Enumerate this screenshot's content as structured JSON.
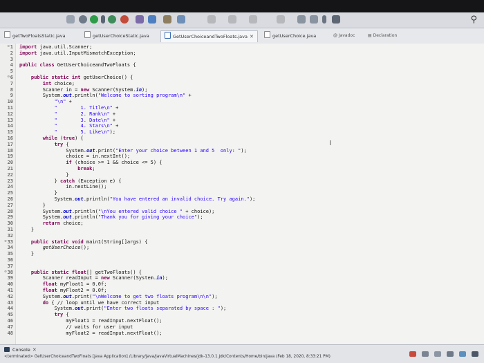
{
  "toolbar": {
    "search_icon": "search-icon"
  },
  "tabs": [
    {
      "label": "getTwoFloatsStatic.java",
      "active": false
    },
    {
      "label": "getUserChoiceStatic.java",
      "active": false
    },
    {
      "label": "GetUserChoiceandTwoFloats.java",
      "active": true,
      "close": "✕"
    },
    {
      "label": "getUserChoice.java",
      "active": false
    }
  ],
  "right_tabs": {
    "javadoc": "Javadoc",
    "declaration": "Declaration"
  },
  "editor": {
    "lines": [
      {
        "n": "1",
        "fold": true,
        "code": [
          [
            "import",
            "kw"
          ],
          [
            " java.util.Scanner;",
            ""
          ]
        ]
      },
      {
        "n": "2",
        "code": [
          [
            "import",
            "kw"
          ],
          [
            " java.util.InputMismatchException;",
            ""
          ]
        ]
      },
      {
        "n": "3",
        "code": []
      },
      {
        "n": "4",
        "code": [
          [
            "public class",
            "kw"
          ],
          [
            " GetUserChoiceandTwoFloats {",
            ""
          ]
        ]
      },
      {
        "n": "5",
        "code": []
      },
      {
        "n": "6",
        "fold": true,
        "code": [
          [
            "    ",
            ""
          ],
          [
            "public static int",
            "kw"
          ],
          [
            " getUserChoice() {",
            ""
          ]
        ]
      },
      {
        "n": "7",
        "code": [
          [
            "        ",
            ""
          ],
          [
            "int",
            "kw"
          ],
          [
            " choice;",
            ""
          ]
        ]
      },
      {
        "n": "8",
        "code": [
          [
            "        Scanner in = ",
            ""
          ],
          [
            "new",
            "kw"
          ],
          [
            " Scanner(System.",
            ""
          ],
          [
            "in",
            "fd"
          ],
          [
            ");",
            ""
          ]
        ]
      },
      {
        "n": "9",
        "code": [
          [
            "        System.",
            ""
          ],
          [
            "out",
            "fd"
          ],
          [
            ".println(",
            ""
          ],
          [
            "\"Welcome to sorting program\\n\"",
            "st"
          ],
          [
            " +",
            ""
          ]
        ]
      },
      {
        "n": "10",
        "code": [
          [
            "            ",
            ""
          ],
          [
            "\"\\n\"",
            "st"
          ],
          [
            " +",
            ""
          ]
        ]
      },
      {
        "n": "11",
        "code": [
          [
            "            ",
            ""
          ],
          [
            "\"",
            "st"
          ],
          [
            "        ",
            ""
          ],
          [
            "1. Title\\n\"",
            "st"
          ],
          [
            " +",
            ""
          ]
        ]
      },
      {
        "n": "12",
        "code": [
          [
            "            ",
            ""
          ],
          [
            "\"",
            "st"
          ],
          [
            "        ",
            ""
          ],
          [
            "2. Rank\\n\"",
            "st"
          ],
          [
            " +",
            ""
          ]
        ]
      },
      {
        "n": "13",
        "code": [
          [
            "            ",
            ""
          ],
          [
            "\"",
            "st"
          ],
          [
            "        ",
            ""
          ],
          [
            "3. Date\\n\"",
            "st"
          ],
          [
            " +",
            ""
          ]
        ]
      },
      {
        "n": "14",
        "code": [
          [
            "            ",
            ""
          ],
          [
            "\"",
            "st"
          ],
          [
            "        ",
            ""
          ],
          [
            "4. Stars\\n\"",
            "st"
          ],
          [
            " +",
            ""
          ]
        ]
      },
      {
        "n": "15",
        "code": [
          [
            "            ",
            ""
          ],
          [
            "\"",
            "st"
          ],
          [
            "        ",
            ""
          ],
          [
            "5. Like\\n\"",
            "st"
          ],
          [
            ");",
            ""
          ]
        ]
      },
      {
        "n": "16",
        "code": [
          [
            "        ",
            ""
          ],
          [
            "while",
            "kw"
          ],
          [
            " (",
            ""
          ],
          [
            "true",
            "kw"
          ],
          [
            ") {",
            ""
          ]
        ]
      },
      {
        "n": "17",
        "code": [
          [
            "            ",
            ""
          ],
          [
            "try",
            "kw"
          ],
          [
            " {",
            ""
          ]
        ]
      },
      {
        "n": "18",
        "code": [
          [
            "                System.",
            ""
          ],
          [
            "out",
            "fd"
          ],
          [
            ".print(",
            ""
          ],
          [
            "\"Enter your choice between 1 and 5  only: \"",
            "st"
          ],
          [
            ");",
            ""
          ]
        ]
      },
      {
        "n": "19",
        "code": [
          [
            "                choice = in.nextInt();",
            ""
          ]
        ]
      },
      {
        "n": "20",
        "code": [
          [
            "                ",
            ""
          ],
          [
            "if",
            "kw"
          ],
          [
            " (choice >= 1 && choice <= 5) {",
            ""
          ]
        ]
      },
      {
        "n": "21",
        "code": [
          [
            "                    ",
            ""
          ],
          [
            "break",
            "kw"
          ],
          [
            ";",
            ""
          ]
        ]
      },
      {
        "n": "22",
        "code": [
          [
            "                }",
            ""
          ]
        ]
      },
      {
        "n": "23",
        "code": [
          [
            "            } ",
            ""
          ],
          [
            "catch",
            "kw"
          ],
          [
            " (Exception e) {",
            ""
          ]
        ]
      },
      {
        "n": "24",
        "code": [
          [
            "                in.nextLine();",
            ""
          ]
        ]
      },
      {
        "n": "25",
        "code": [
          [
            "            }",
            ""
          ]
        ]
      },
      {
        "n": "26",
        "code": [
          [
            "            System.",
            ""
          ],
          [
            "out",
            "fd"
          ],
          [
            ".println(",
            ""
          ],
          [
            "\"You have entered an invalid choice. Try again.\"",
            "st"
          ],
          [
            ");",
            ""
          ]
        ]
      },
      {
        "n": "27",
        "code": [
          [
            "        }",
            ""
          ]
        ]
      },
      {
        "n": "28",
        "code": [
          [
            "        System.",
            ""
          ],
          [
            "out",
            "fd"
          ],
          [
            ".println(",
            ""
          ],
          [
            "\"\\nYou entered valid choice \"",
            "st"
          ],
          [
            " + choice);",
            ""
          ]
        ]
      },
      {
        "n": "29",
        "code": [
          [
            "        System.",
            ""
          ],
          [
            "out",
            "fd"
          ],
          [
            ".println(",
            ""
          ],
          [
            "\"Thank you for giving your choice\"",
            "st"
          ],
          [
            ");",
            ""
          ]
        ]
      },
      {
        "n": "30",
        "code": [
          [
            "        ",
            ""
          ],
          [
            "return",
            "kw"
          ],
          [
            " choice;",
            ""
          ]
        ]
      },
      {
        "n": "31",
        "code": [
          [
            "    }",
            ""
          ]
        ]
      },
      {
        "n": "32",
        "code": []
      },
      {
        "n": "33",
        "fold": true,
        "code": [
          [
            "    ",
            ""
          ],
          [
            "public static void",
            "kw"
          ],
          [
            " main1(String[]args) {",
            ""
          ]
        ]
      },
      {
        "n": "34",
        "code": [
          [
            "        ",
            ""
          ],
          [
            "getUserChoice",
            "it"
          ],
          [
            "();",
            ""
          ]
        ]
      },
      {
        "n": "35",
        "code": [
          [
            "    }",
            ""
          ]
        ]
      },
      {
        "n": "36",
        "code": []
      },
      {
        "n": "37",
        "code": []
      },
      {
        "n": "38",
        "fold": true,
        "code": [
          [
            "    ",
            ""
          ],
          [
            "public static float",
            "kw"
          ],
          [
            "[] getTwoFloats() {",
            ""
          ]
        ]
      },
      {
        "n": "39",
        "code": [
          [
            "        Scanner readInput = ",
            ""
          ],
          [
            "new",
            "kw"
          ],
          [
            " Scanner(System.",
            ""
          ],
          [
            "in",
            "fd"
          ],
          [
            ");",
            ""
          ]
        ]
      },
      {
        "n": "40",
        "code": [
          [
            "        ",
            ""
          ],
          [
            "float",
            "kw"
          ],
          [
            " myFloat1 = 0.0f;",
            ""
          ]
        ]
      },
      {
        "n": "41",
        "code": [
          [
            "        ",
            ""
          ],
          [
            "float",
            "kw"
          ],
          [
            " myFloat2 = 0.0f;",
            ""
          ]
        ]
      },
      {
        "n": "42",
        "code": [
          [
            "        System.",
            ""
          ],
          [
            "out",
            "fd"
          ],
          [
            ".print(",
            ""
          ],
          [
            "\"\\nWelcome to get two floats program\\n\\n\"",
            "st"
          ],
          [
            ");",
            ""
          ]
        ]
      },
      {
        "n": "43",
        "code": [
          [
            "        ",
            ""
          ],
          [
            "do",
            "kw"
          ],
          [
            " { // loop until we have correct input",
            ""
          ]
        ]
      },
      {
        "n": "44",
        "code": [
          [
            "            System.",
            ""
          ],
          [
            "out",
            "fd"
          ],
          [
            ".print(",
            ""
          ],
          [
            "\"Enter two floats separated by space : \"",
            "st"
          ],
          [
            ");",
            ""
          ]
        ]
      },
      {
        "n": "45",
        "code": [
          [
            "            ",
            ""
          ],
          [
            "try",
            "kw"
          ],
          [
            " {",
            ""
          ]
        ]
      },
      {
        "n": "46",
        "code": [
          [
            "                myFloat1 = readInput.nextFloat();",
            ""
          ]
        ]
      },
      {
        "n": "47",
        "code": [
          [
            "                // waits for user input",
            ""
          ]
        ]
      },
      {
        "n": "48",
        "code": [
          [
            "                myFloat2 = readInput.nextFloat();",
            ""
          ]
        ]
      }
    ]
  },
  "console": {
    "title": "Console",
    "close": "✕",
    "status": "<terminated> GetUserChoiceandTwoFloats [Java Application] /Library/Java/JavaVirtualMachines/jdk-13.0.1.jdk/Contents/Home/bin/java (Feb 18, 2020, 8:33:21 PM)"
  }
}
